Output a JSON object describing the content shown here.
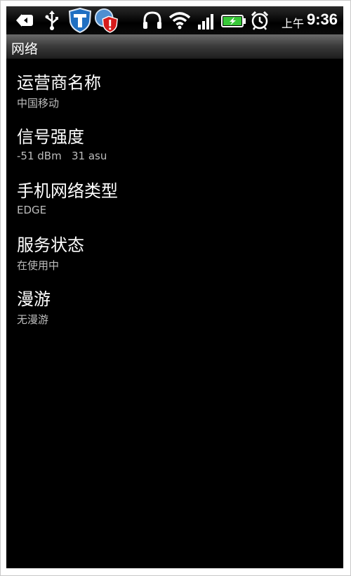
{
  "status_bar": {
    "icons": [
      "back-arrow-icon",
      "usb-icon",
      "shield-t-icon",
      "alert-badge-icon",
      "headphones-icon",
      "wifi-icon",
      "signal-icon",
      "battery-charging-icon",
      "alarm-clock-icon"
    ],
    "ampm": "上午",
    "time": "9:36",
    "colors": {
      "wifi_signal": "#ffffff",
      "battery": "#39c839",
      "shield": "#1f6fc2",
      "alert": "#d61b1b"
    }
  },
  "title_bar": {
    "title": "网络"
  },
  "network": {
    "items": [
      {
        "label": "运营商名称",
        "value": "中国移动"
      },
      {
        "label": "信号强度",
        "value": "-51 dBm   31 asu"
      },
      {
        "label": "手机网络类型",
        "value": "EDGE"
      },
      {
        "label": "服务状态",
        "value": "在使用中"
      },
      {
        "label": "漫游",
        "value": "无漫游"
      }
    ]
  }
}
